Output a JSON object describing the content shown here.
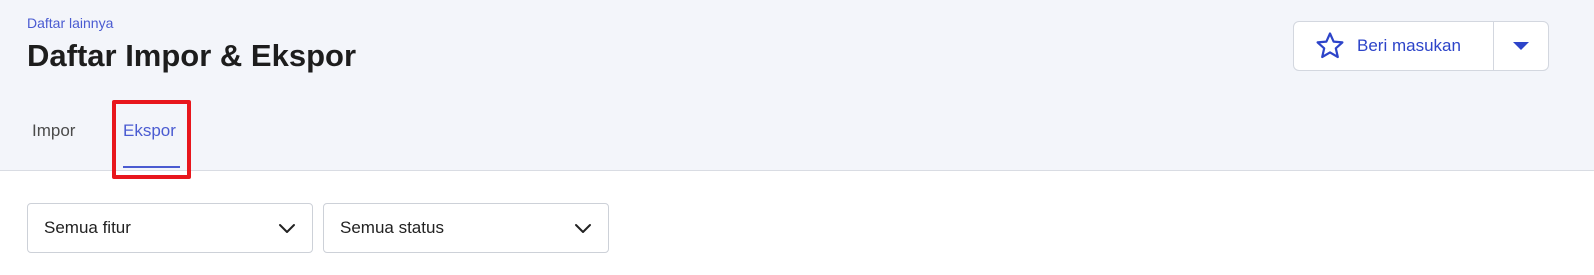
{
  "header": {
    "breadcrumb": "Daftar lainnya",
    "title": "Daftar Impor & Ekspor"
  },
  "feedback": {
    "label": "Beri masukan",
    "icon": "star-icon",
    "dropdown_icon": "caret-down-icon"
  },
  "tabs": [
    {
      "label": "Impor",
      "active": false
    },
    {
      "label": "Ekspor",
      "active": true
    }
  ],
  "filters": {
    "feature": {
      "value": "Semua fitur",
      "icon": "chevron-down-icon"
    },
    "status": {
      "value": "Semua status",
      "icon": "chevron-down-icon"
    }
  },
  "colors": {
    "accent": "#4a5bd1",
    "highlight": "#e8161c",
    "header_bg": "#f3f5fa"
  }
}
